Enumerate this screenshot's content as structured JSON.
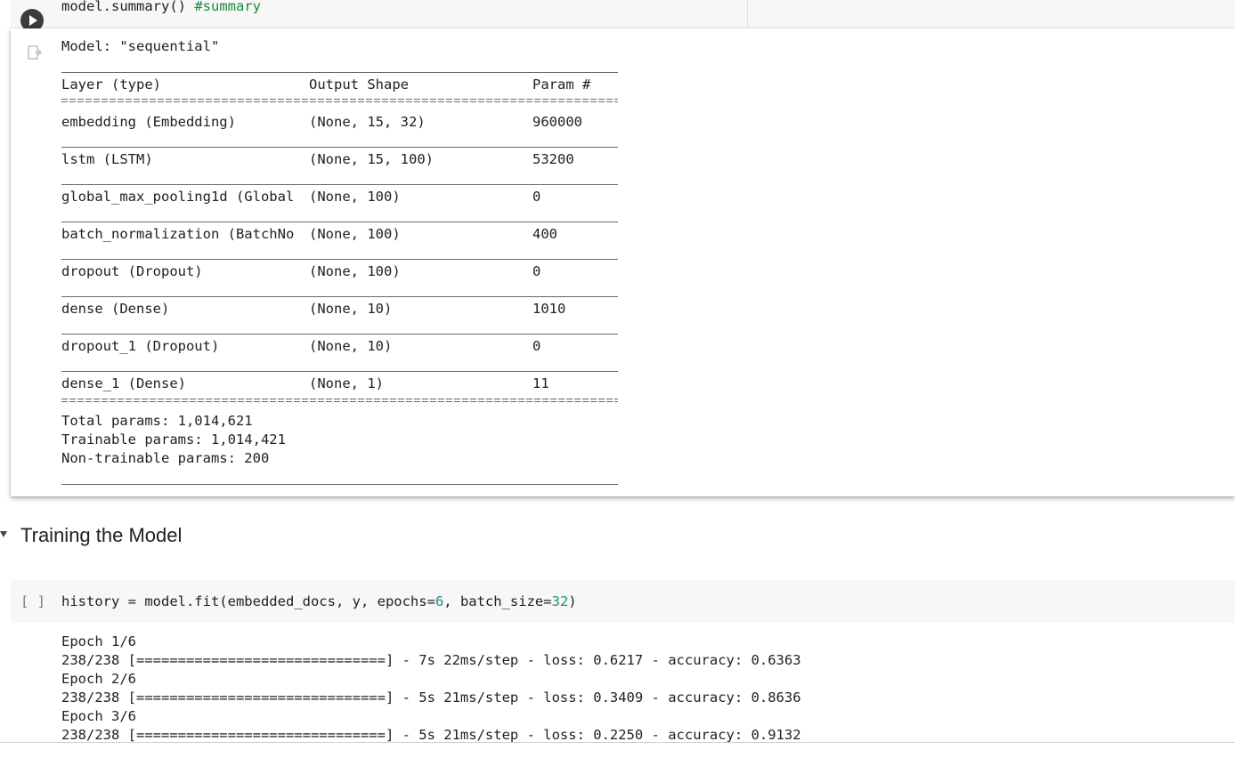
{
  "cell1": {
    "code_text": "model.summary()",
    "comment": "#summary",
    "output": {
      "model_line": "Model: \"sequential\"",
      "headers": [
        "Layer (type)",
        "Output Shape",
        "Param #"
      ],
      "rows": [
        [
          "embedding (Embedding)",
          "(None, 15, 32)",
          "960000"
        ],
        [
          "lstm (LSTM)",
          "(None, 15, 100)",
          "53200"
        ],
        [
          "global_max_pooling1d (Global",
          "(None, 100)",
          "0"
        ],
        [
          "batch_normalization (BatchNo",
          "(None, 100)",
          "400"
        ],
        [
          "dropout (Dropout)",
          "(None, 100)",
          "0"
        ],
        [
          "dense (Dense)",
          "(None, 10)",
          "1010"
        ],
        [
          "dropout_1 (Dropout)",
          "(None, 10)",
          "0"
        ],
        [
          "dense_1 (Dense)",
          "(None, 1)",
          "11"
        ]
      ],
      "total_params": "Total params: 1,014,621",
      "trainable_params": "Trainable params: 1,014,421",
      "non_trainable_params": "Non-trainable params: 200"
    }
  },
  "section": {
    "title": "Training the Model"
  },
  "cell2": {
    "bracket": "[ ]",
    "code": {
      "before_epochs": "history = model.fit(embedded_docs, y, epochs=",
      "epochs": "6",
      "between": ", batch_size=",
      "batch_size": "32",
      "after": ")"
    },
    "log": [
      "Epoch 1/6",
      "238/238 [==============================] - 7s 22ms/step - loss: 0.6217 - accuracy: 0.6363",
      "Epoch 2/6",
      "238/238 [==============================] - 5s 21ms/step - loss: 0.3409 - accuracy: 0.8636",
      "Epoch 3/6",
      "238/238 [==============================] - 5s 21ms/step - loss: 0.2250 - accuracy: 0.9132"
    ]
  },
  "icons": {
    "run": "play-icon",
    "output": "output-arrow-icon",
    "section_toggle": "collapse-triangle-icon"
  }
}
